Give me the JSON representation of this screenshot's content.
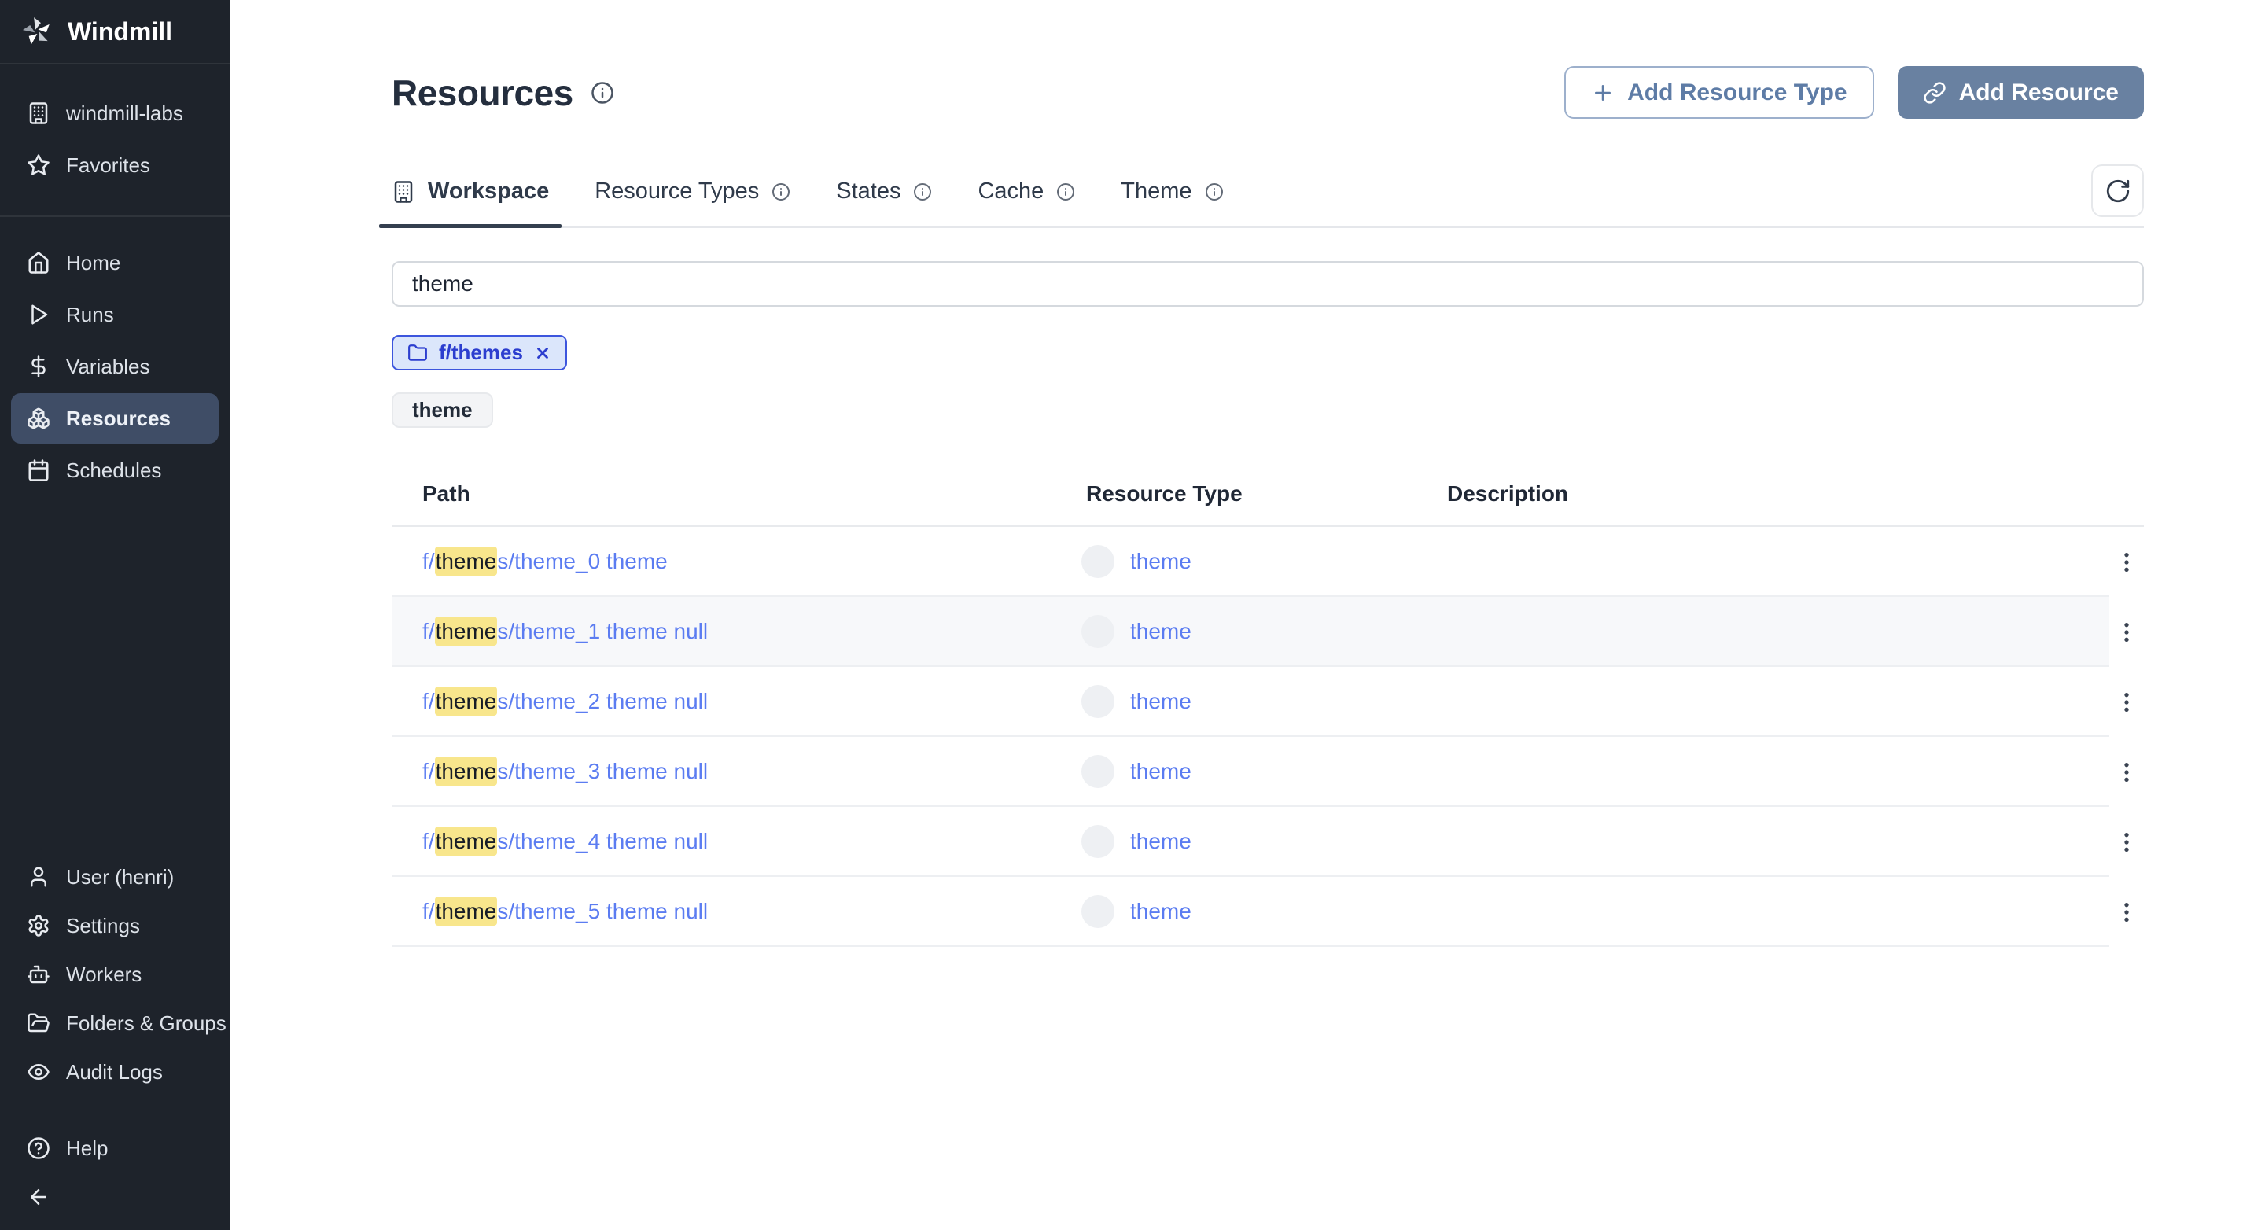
{
  "app": {
    "name": "Windmill"
  },
  "sidebar": {
    "workspace_items": [
      {
        "label": "windmill-labs",
        "icon": "building"
      },
      {
        "label": "Favorites",
        "icon": "star"
      }
    ],
    "nav_items": [
      {
        "label": "Home",
        "icon": "home",
        "active": false
      },
      {
        "label": "Runs",
        "icon": "play",
        "active": false
      },
      {
        "label": "Variables",
        "icon": "dollar",
        "active": false
      },
      {
        "label": "Resources",
        "icon": "boxes",
        "active": true
      },
      {
        "label": "Schedules",
        "icon": "calendar",
        "active": false
      }
    ],
    "bottom_items": [
      {
        "label": "User (henri)",
        "icon": "user"
      },
      {
        "label": "Settings",
        "icon": "gear"
      },
      {
        "label": "Workers",
        "icon": "bot"
      },
      {
        "label": "Folders & Groups",
        "icon": "folder-open"
      },
      {
        "label": "Audit Logs",
        "icon": "eye"
      }
    ],
    "help_items": [
      {
        "label": "Help",
        "icon": "help"
      },
      {
        "label": "",
        "icon": "arrow-left"
      }
    ]
  },
  "header": {
    "title": "Resources",
    "buttons": [
      {
        "label": "Add Resource Type",
        "style": "outline",
        "icon": "plus"
      },
      {
        "label": "Add Resource",
        "style": "primary",
        "icon": "link"
      }
    ]
  },
  "tabs": [
    {
      "label": "Workspace",
      "icon": "building",
      "active": true,
      "info": false
    },
    {
      "label": "Resource Types",
      "active": false,
      "info": true
    },
    {
      "label": "States",
      "active": false,
      "info": true
    },
    {
      "label": "Cache",
      "active": false,
      "info": true
    },
    {
      "label": "Theme",
      "active": false,
      "info": true
    }
  ],
  "filters": {
    "search_value": "theme",
    "chip": {
      "label": "f/themes"
    },
    "badge": "theme"
  },
  "table": {
    "columns": [
      "Path",
      "Resource Type",
      "Description"
    ],
    "rows": [
      {
        "path_prefix": "f/",
        "path_highlight": "theme",
        "path_suffix": "s/theme_0 theme",
        "resource_type": "theme",
        "description": "",
        "hover": false
      },
      {
        "path_prefix": "f/",
        "path_highlight": "theme",
        "path_suffix": "s/theme_1 theme null",
        "resource_type": "theme",
        "description": "",
        "hover": true
      },
      {
        "path_prefix": "f/",
        "path_highlight": "theme",
        "path_suffix": "s/theme_2 theme null",
        "resource_type": "theme",
        "description": "",
        "hover": false
      },
      {
        "path_prefix": "f/",
        "path_highlight": "theme",
        "path_suffix": "s/theme_3 theme null",
        "resource_type": "theme",
        "description": "",
        "hover": false
      },
      {
        "path_prefix": "f/",
        "path_highlight": "theme",
        "path_suffix": "s/theme_4 theme null",
        "resource_type": "theme",
        "description": "",
        "hover": false
      },
      {
        "path_prefix": "f/",
        "path_highlight": "theme",
        "path_suffix": "s/theme_5 theme null",
        "resource_type": "theme",
        "description": "",
        "hover": false
      }
    ]
  },
  "colors": {
    "sidebar_bg": "#1e232b",
    "sidebar_active": "#3f4d66",
    "primary_button": "#6981a1",
    "link_blue": "#5b7cf1",
    "highlight_yellow": "#f8e68c",
    "chip_blue": "#3c55dd"
  }
}
